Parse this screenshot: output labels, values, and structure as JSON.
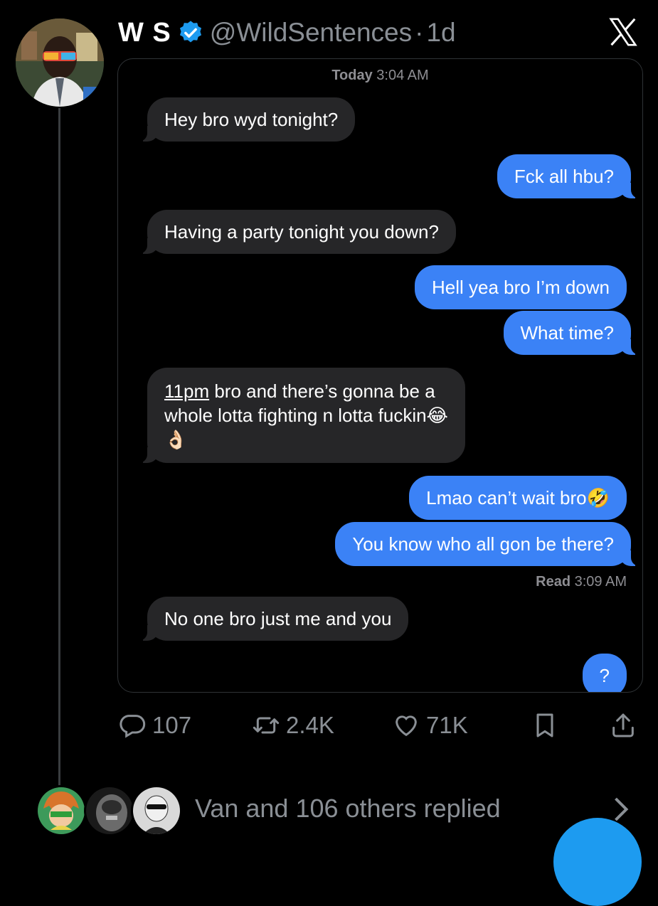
{
  "post": {
    "display_name": "W S",
    "handle": "@WildSentences",
    "separator": "·",
    "age": "1d"
  },
  "conversation": {
    "timestamp_day": "Today",
    "timestamp_time": "3:04 AM",
    "messages": [
      {
        "side": "in",
        "text": "Hey bro wyd tonight?"
      },
      {
        "side": "out",
        "text": "Fck all hbu?"
      },
      {
        "side": "in",
        "text": "Having a party tonight you down?"
      },
      {
        "side": "out",
        "text": "Hell yea bro I’m down"
      },
      {
        "side": "out",
        "text": "What time?"
      },
      {
        "side": "in",
        "text_link": "11pm",
        "text_line1": " bro and there’s gonna be a",
        "text_line2": "whole lotta fighting n lotta fuckin😂",
        "text_line3": "👌🏻"
      },
      {
        "side": "out",
        "text": "Lmao can’t wait bro🤣"
      },
      {
        "side": "out",
        "text": "You know who all gon be there?"
      },
      {
        "side": "in",
        "text": "No one bro just me and you"
      },
      {
        "side": "out",
        "text": "?"
      }
    ],
    "read_label": "Read",
    "read_time": "3:09 AM"
  },
  "actions": {
    "replies": "107",
    "reposts": "2.4K",
    "likes": "71K"
  },
  "replied": {
    "text": "Van and 106 others replied"
  },
  "colors": {
    "accent": "#1d9bf0",
    "imessage_blue": "#3b82f6",
    "incoming_gray": "#262628",
    "muted": "#8a8f95"
  }
}
